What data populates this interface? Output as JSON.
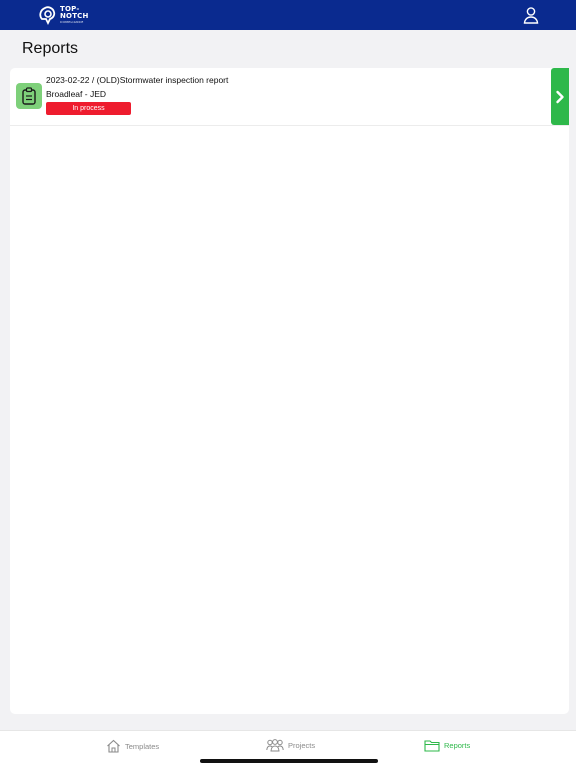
{
  "app": {
    "logo": {
      "line1": "TOP-",
      "line2": "NOTCH",
      "line3": "COMPLIANCE"
    },
    "brand_color": "#0a2a8f",
    "accent_color": "#2eb84a",
    "user_icon": "user-icon"
  },
  "page": {
    "title": "Reports"
  },
  "reports": [
    {
      "title": "2023-02-22 / (OLD)Stormwater inspection report",
      "project": "Broadleaf - JED",
      "status": "In process",
      "status_color": "#ee1c2e",
      "icon": "clipboard-icon"
    }
  ],
  "tabs": [
    {
      "label": "Templates",
      "icon": "home-icon",
      "active": false
    },
    {
      "label": "Projects",
      "icon": "people-icon",
      "active": false
    },
    {
      "label": "Reports",
      "icon": "folder-icon",
      "active": true
    }
  ]
}
